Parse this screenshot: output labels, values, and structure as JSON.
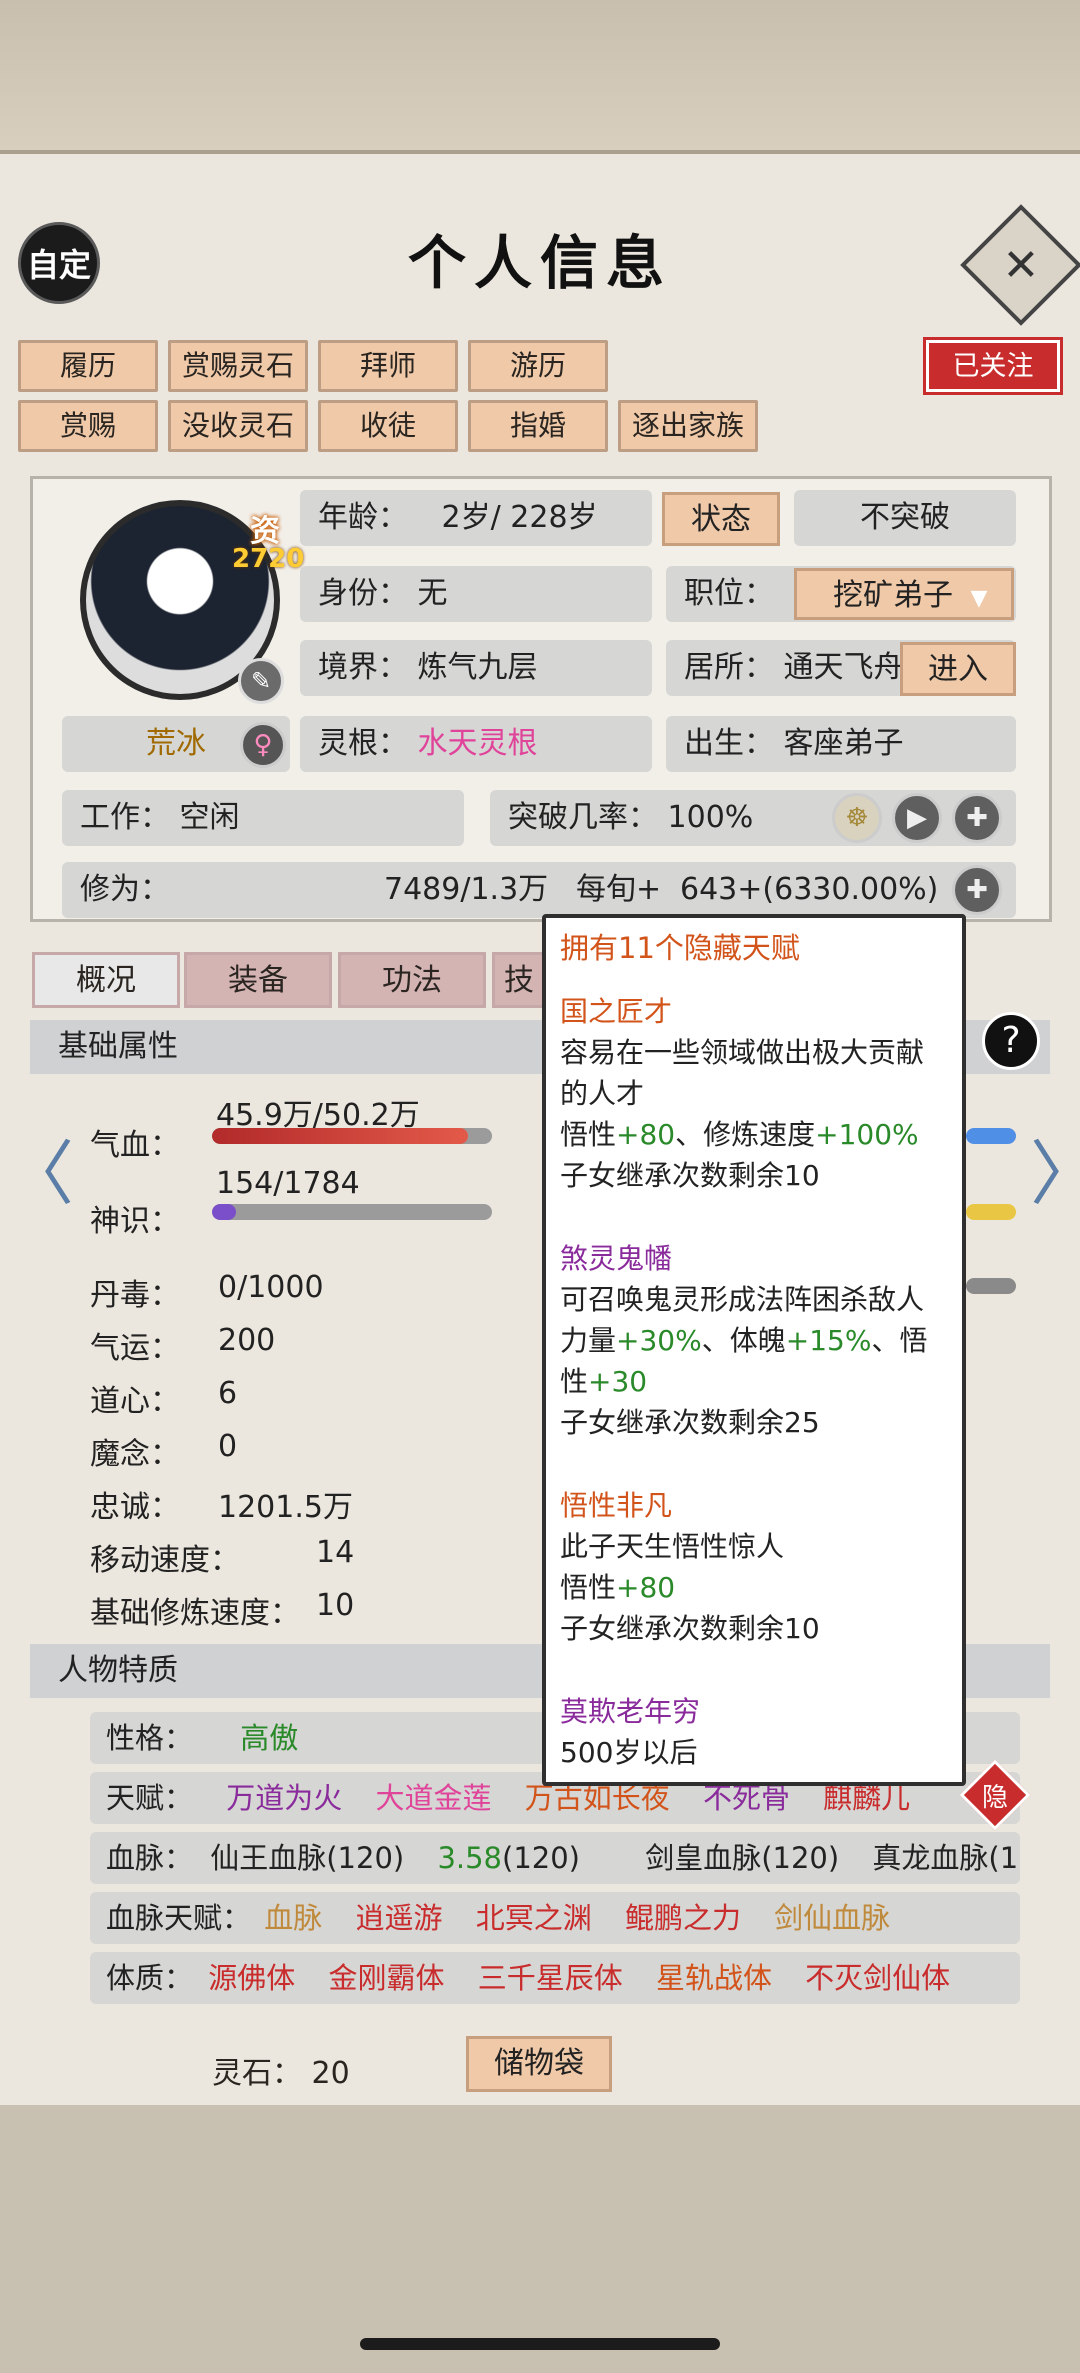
{
  "header": {
    "custom_label": "自定",
    "title": "个人信息",
    "close_glyph": "✕"
  },
  "actions_row1": [
    "履历",
    "赏赐灵石",
    "拜师",
    "游历"
  ],
  "actions_row2": [
    "赏赐",
    "没收灵石",
    "收徒",
    "指婚",
    "逐出家族"
  ],
  "followed_label": "已关注",
  "profile": {
    "aptitude_label": "资",
    "aptitude_value": "2720",
    "name": "荒冰",
    "age_label": "年龄：",
    "age_value": "2岁/ 228岁",
    "status_btn": "状态",
    "breakthrough_btn": "不突破",
    "identity_label": "身份：",
    "identity_value": "无",
    "position_label": "职位：",
    "position_value": "挖矿弟子",
    "realm_label": "境界：",
    "realm_value": "炼气九层",
    "residence_label": "居所：",
    "residence_value": "通天飞舟",
    "enter_btn": "进入",
    "root_label": "灵根：",
    "root_value": "水天灵根",
    "birth_label": "出生：",
    "birth_value": "客座弟子",
    "work_label": "工作：",
    "work_value": "空闲",
    "rate_label": "突破几率：",
    "rate_value": "100%",
    "cultivation_label": "修为：",
    "cultivation_value": "7489/1.3万",
    "per_tick_label": "每旬+",
    "per_tick_value": "643+(6330.00%)"
  },
  "sub_tabs": [
    "概况",
    "装备",
    "功法",
    "技"
  ],
  "basic": {
    "section_title": "基础属性",
    "hp_label": "气血：",
    "hp_value": "45.9万/50.2万",
    "hp_fraction": 0.914,
    "sense_label": "神识：",
    "sense_value": "154/1784",
    "sense_fraction": 0.086,
    "stats": [
      {
        "label": "丹毒：",
        "value": "0/1000"
      },
      {
        "label": "气运：",
        "value": "200"
      },
      {
        "label": "道心：",
        "value": "6"
      },
      {
        "label": "魔念：",
        "value": "0"
      },
      {
        "label": "忠诚：",
        "value": "1201.5万"
      },
      {
        "label": "移动速度：",
        "value": "14"
      },
      {
        "label": "基础修炼速度：",
        "value": "10"
      }
    ]
  },
  "traits": {
    "section_title": "人物特质",
    "personality_label": "性格：",
    "personality_value": "高傲",
    "talent_label": "天赋：",
    "talents": [
      "万道为火",
      "大道金莲",
      "万古如长夜",
      "不死骨",
      "麒麟儿"
    ],
    "hidden_label": "隐",
    "bloodline_label": "血脉：",
    "bloodline_1": "仙王血脉(120)",
    "bloodline_2_num": "3.58",
    "bloodline_2_rest": "(120)",
    "bloodline_3": "剑皇血脉(120)",
    "bloodline_4": "真龙血脉(1",
    "blood_talent_label": "血脉天赋：",
    "blood_talents": [
      "血脉",
      "逍遥游",
      "北冥之渊",
      "鲲鹏之力",
      "剑仙血脉"
    ],
    "physique_label": "体质：",
    "physiques": [
      "源佛体",
      "金刚霸体",
      "三千星辰体",
      "星轨战体",
      "不灭剑仙体"
    ]
  },
  "footer": {
    "stone_label": "灵石：",
    "stone_value": "20",
    "bag_btn": "储物袋"
  },
  "popup": {
    "title": "拥有11个隐藏天赋",
    "t1_name": "国之匠才",
    "t1_desc": "容易在一些领域做出极大贡献的人才",
    "t1_a": "悟性",
    "t1_a_val": "+80",
    "t1_b": "、修炼速度",
    "t1_b_val": "+100%",
    "t1_inherit": "子女继承次数剩余10",
    "t2_name": "煞灵鬼幡",
    "t2_desc": "可召唤鬼灵形成法阵困杀敌人",
    "t2_a": "力量",
    "t2_a_val": "+30%",
    "t2_b": "、体魄",
    "t2_b_val": "+15%",
    "t2_c": "、悟性",
    "t2_c_val": "+30",
    "t2_inherit": "子女继承次数剩余25",
    "t3_name": "悟性非凡",
    "t3_desc": "此子天生悟性惊人",
    "t3_a": "悟性",
    "t3_a_val": "+80",
    "t3_inherit": "子女继承次数剩余10",
    "t4_name": "莫欺老年穷",
    "t4_desc": "500岁以后"
  },
  "colors": {
    "tan": "#efc9a8",
    "red": "#c92c2c",
    "hp_bar": "#c8383a",
    "sense_bar": "#7b4fc9",
    "pink": "#e0449a",
    "green": "#2a8a2a",
    "orange": "#d2541a"
  }
}
